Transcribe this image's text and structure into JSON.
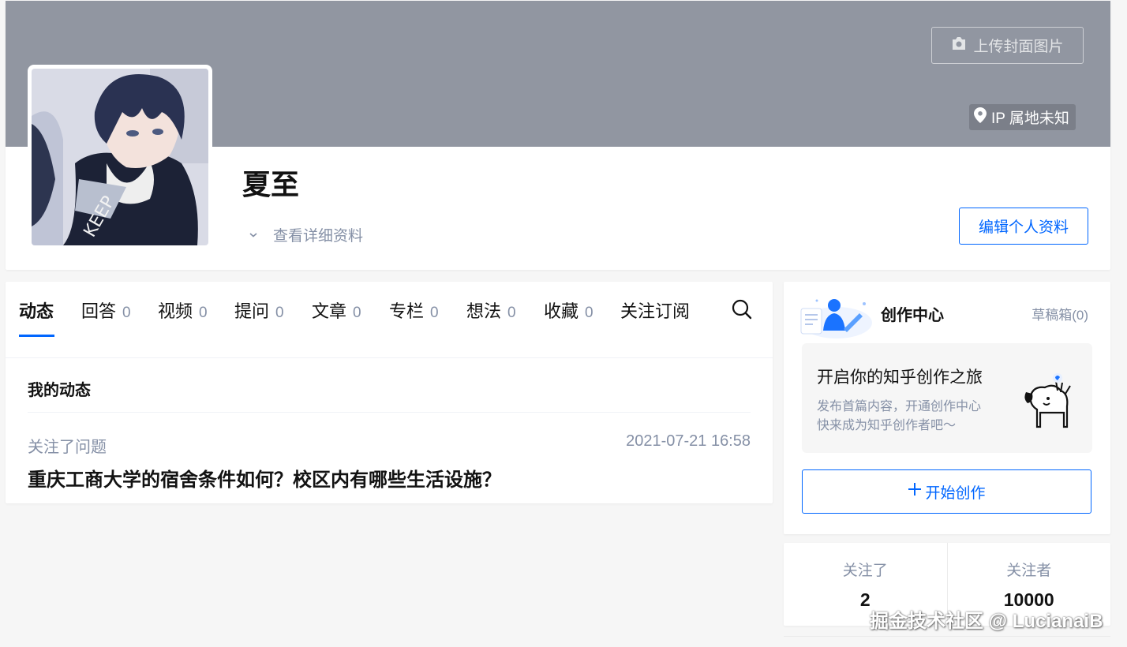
{
  "profile": {
    "upload_cover_label": "上传封面图片",
    "ip_location": "IP 属地未知",
    "name": "夏至",
    "detail_link": "查看详细资料",
    "edit_button": "编辑个人资料"
  },
  "tabs": [
    {
      "label": "动态",
      "count": ""
    },
    {
      "label": "回答",
      "count": "0"
    },
    {
      "label": "视频",
      "count": "0"
    },
    {
      "label": "提问",
      "count": "0"
    },
    {
      "label": "文章",
      "count": "0"
    },
    {
      "label": "专栏",
      "count": "0"
    },
    {
      "label": "想法",
      "count": "0"
    },
    {
      "label": "收藏",
      "count": "0"
    },
    {
      "label": "关注订阅",
      "count": ""
    }
  ],
  "feed": {
    "section_title": "我的动态",
    "items": [
      {
        "action": "关注了问题",
        "time": "2021-07-21 16:58",
        "title": "重庆工商大学的宿舍条件如何？校区内有哪些生活设施？"
      }
    ]
  },
  "creator": {
    "title": "创作中心",
    "drafts": "草稿箱(0)",
    "promo_title": "开启你的知乎创作之旅",
    "promo_lines": [
      "发布首篇内容，开通创作中心",
      "快来成为知乎创作者吧～"
    ],
    "start_button": "开始创作"
  },
  "follow": {
    "following_label": "关注了",
    "following_count": "2",
    "followers_label": "关注者",
    "followers_count": "10000"
  },
  "watermark": "掘金技术社区 @ LucianaiB",
  "colors": {
    "accent": "#0066ff",
    "cover": "#9196a1",
    "muted": "#8590a6",
    "page_bg": "#f6f6f6"
  }
}
